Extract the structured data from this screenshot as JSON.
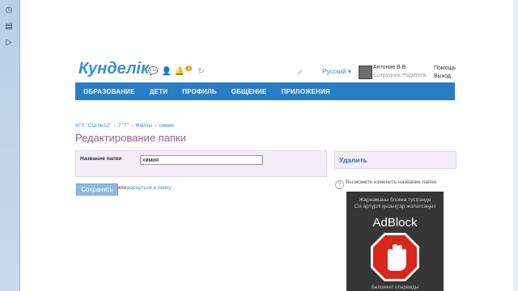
{
  "rail": {
    "icons": [
      "clock-icon",
      "notes-icon",
      "play-icon"
    ]
  },
  "header": {
    "logo_text": "Кунделік",
    "language": "Русский ▾",
    "notification_count": "1",
    "user_name": "Антоние В.В.",
    "user_role": "Сотрудник Родитель",
    "help": "Помощь",
    "logout": "Выход"
  },
  "nav": {
    "items": [
      "ОБРАЗОВАНИЕ",
      "ДЕТИ",
      "ПРОФИЛЬ",
      "ОБЩЕНИЕ",
      "ПРИЛОЖЕНИЯ"
    ]
  },
  "breadcrumb": {
    "items": [
      "КГУ \"СШ №12\"",
      "7 \"Г\"",
      "Файлы",
      "химия"
    ],
    "separator": "›"
  },
  "page": {
    "title": "Редактирование папки"
  },
  "form": {
    "label": "Название папки",
    "value": "химия",
    "save_label": "Сохранить",
    "or_text": "или",
    "back_link": "вернуться в папку"
  },
  "sidebar": {
    "delete_label": "Удалить",
    "hint": "Вы можете изменить название папки."
  },
  "ad": {
    "line1": "Жарнаманы блокка түсірзнде",
    "line2": "Сіз артүрлі қызықтар жолатсаңыз",
    "brand": "AdBlock",
    "bottom": "Бөлшекет отырмады"
  },
  "colors": {
    "nav": "#2a7cc7",
    "title": "#9b5a9b",
    "link": "#3a8fd1"
  }
}
